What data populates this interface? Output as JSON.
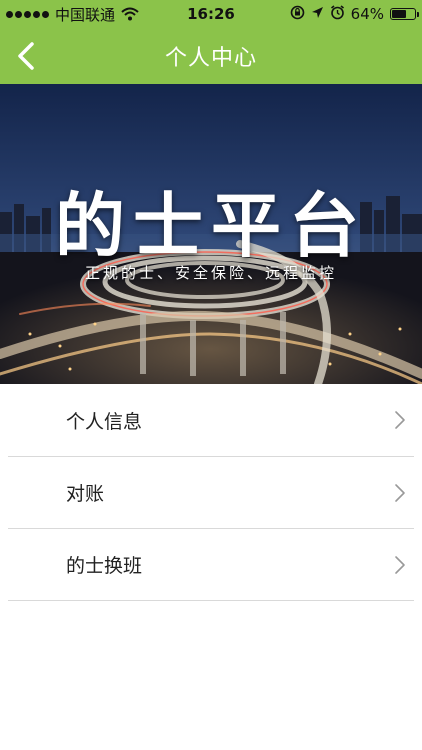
{
  "status_bar": {
    "carrier": "中国联通",
    "time": "16:26",
    "battery_percent": "64%",
    "battery_level": 0.64
  },
  "nav": {
    "title": "个人中心",
    "back_icon": "chevron-left-icon"
  },
  "banner": {
    "title": "的士平台",
    "subtitle": "正规的士、安全保险、远程监控"
  },
  "menu": {
    "items": [
      {
        "label": "个人信息"
      },
      {
        "label": "对账"
      },
      {
        "label": "的士换班"
      }
    ],
    "chevron_icon": "chevron-right-icon"
  },
  "colors": {
    "header": "#8bc34a",
    "divider": "#d9d9d9",
    "chevron": "#999999"
  }
}
